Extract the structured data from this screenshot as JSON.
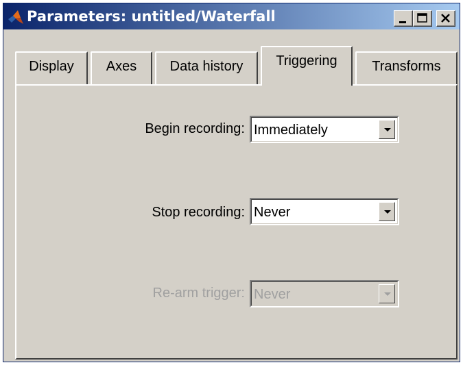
{
  "window": {
    "title": "Parameters: untitled/Waterfall",
    "icon": "matlab-icon",
    "controls": [
      "minimize-icon",
      "maximize-icon",
      "close-icon"
    ]
  },
  "tabs": [
    {
      "label": "Display",
      "selected": false
    },
    {
      "label": "Axes",
      "selected": false
    },
    {
      "label": "Data history",
      "selected": false
    },
    {
      "label": "Triggering",
      "selected": true
    },
    {
      "label": "Transforms",
      "selected": false
    }
  ],
  "fields": {
    "begin": {
      "label": "Begin recording:",
      "value": "Immediately",
      "enabled": true
    },
    "stop": {
      "label": "Stop recording:",
      "value": "Never",
      "enabled": true
    },
    "rearm": {
      "label": "Re-arm trigger:",
      "value": "Never",
      "enabled": false
    }
  }
}
